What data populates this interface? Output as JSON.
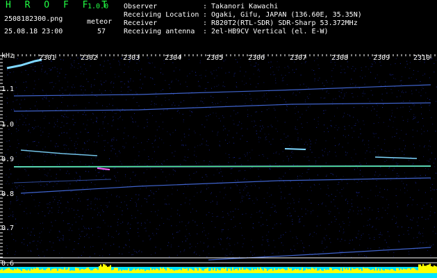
{
  "header": {
    "app_title": "H R O F F T",
    "version": "1.0.0",
    "filename": "2508182300.png",
    "datetime": "25.08.18 23:00",
    "meteor_label": "meteor",
    "meteor_count": "57",
    "meta": [
      {
        "key": "Observer",
        "value": "Takanori Kawachi"
      },
      {
        "key": "Receiving Location",
        "value": "Ogaki, Gifu, JAPAN (136.60E, 35.35N)"
      },
      {
        "key": "Receiver",
        "value": "R820T2(RTL-SDR) SDR-Sharp 53.372MHz"
      },
      {
        "key": "Receiving antenna",
        "value": "2el-HB9CV Vertical (el. E-W)"
      }
    ],
    "separator": ":"
  },
  "spectrogram": {
    "freq_unit": "kHz",
    "time_ticks": [
      "2301",
      "2302",
      "2303",
      "2304",
      "2305",
      "2306",
      "2307",
      "2308",
      "2309",
      "2310"
    ],
    "freq_ticks": [
      "1.1",
      "1.0",
      "0.9",
      "0.8",
      "0.7",
      "0.6"
    ],
    "colors": {
      "background": "#000000",
      "noise": "#1b2aa8",
      "signal": "#7fd8ff",
      "hot": "#ff66ff",
      "green": "#22ff44",
      "amplitude_yellow": "#ffff00",
      "amplitude_cyan": "#00e5ff"
    }
  }
}
